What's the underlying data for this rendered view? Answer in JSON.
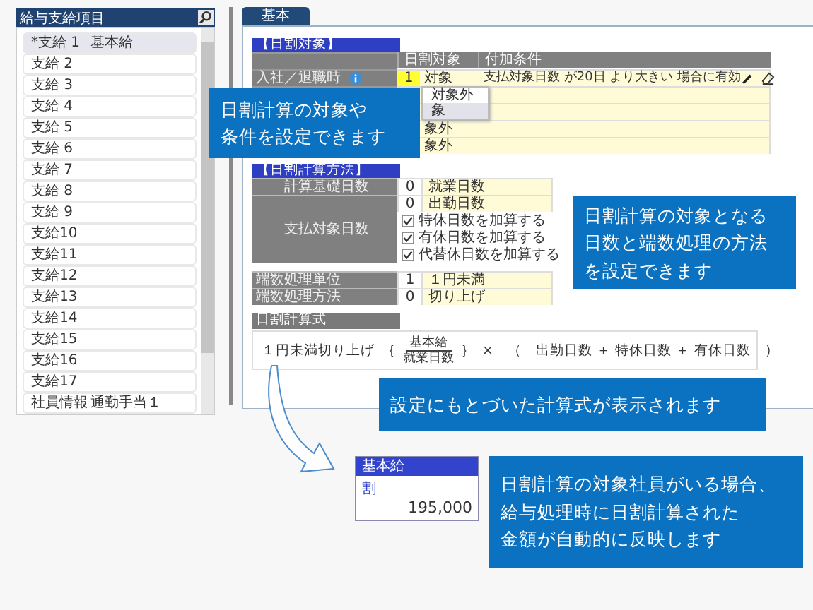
{
  "sidebar": {
    "title": "給与支給項目",
    "items": [
      {
        "code": "*支給 1",
        "name": "基本給",
        "selected": true
      },
      {
        "code": "支給 2",
        "selected": false
      },
      {
        "code": "支給 3",
        "selected": false
      },
      {
        "code": "支給 4",
        "selected": false
      },
      {
        "code": "支給 5",
        "selected": false
      },
      {
        "code": "支給 6",
        "selected": false
      },
      {
        "code": "支給 7",
        "selected": false
      },
      {
        "code": "支給 8",
        "selected": false
      },
      {
        "code": "支給 9",
        "selected": false
      },
      {
        "code": "支給10",
        "selected": false
      },
      {
        "code": "支給11",
        "selected": false
      },
      {
        "code": "支給12",
        "selected": false
      },
      {
        "code": "支給13",
        "selected": false
      },
      {
        "code": "支給14",
        "selected": false
      },
      {
        "code": "支給15",
        "selected": false
      },
      {
        "code": "支給16",
        "selected": false
      },
      {
        "code": "支給17",
        "selected": false
      },
      {
        "code": "社員情報",
        "name": "通勤手当１",
        "selected": false
      }
    ]
  },
  "tabs": [
    {
      "label": "基本",
      "selected": true
    }
  ],
  "target_section": {
    "title": "【日割対象】",
    "columns": [
      "日割対象",
      "付加条件"
    ],
    "rows": [
      {
        "label": "入社／退職時",
        "code": "1",
        "value": "対象",
        "condition": "支払対象日数 が20日 より大きい 場合に有効"
      },
      {},
      {},
      {
        "value": "象外"
      },
      {
        "value": "象外"
      }
    ],
    "dropdown": [
      {
        "label": "対象外",
        "selected": false
      },
      {
        "label": "象",
        "selected": true
      }
    ]
  },
  "method_section": {
    "title": "【日割計算方法】",
    "rows": [
      {
        "label": "計算基礎日数",
        "items": [
          {
            "kind": "value",
            "code": "0",
            "text": "就業日数"
          }
        ]
      },
      {
        "label": "支払対象日数",
        "items": [
          {
            "kind": "value",
            "code": "0",
            "text": "出勤日数"
          },
          {
            "kind": "check",
            "checked": true,
            "text": "特休日数を加算する"
          },
          {
            "kind": "check",
            "checked": true,
            "text": "有休日数を加算する"
          },
          {
            "kind": "check",
            "checked": true,
            "text": "代替休日数を加算する"
          }
        ]
      }
    ]
  },
  "rounding": [
    {
      "label": "端数処理単位",
      "code": "1",
      "value": "１円未満"
    },
    {
      "label": "端数処理方法",
      "code": "0",
      "value": "切り上げ"
    }
  ],
  "formula": {
    "title": "日割計算式",
    "prefix": "１円未満切り上げ",
    "open_brace": "｛",
    "numerator": "基本給",
    "denominator": "就業日数",
    "close_brace": "｝",
    "rest": "×　（　出勤日数 ＋ 特休日数 ＋ 有休日数　）"
  },
  "result_card": {
    "title": "基本給",
    "mark": "割",
    "amount": "195,000"
  },
  "callouts": [
    {
      "lines": [
        "日割計算の対象や",
        "条件を設定できます"
      ]
    },
    {
      "lines": [
        "日割計算の対象となる",
        "日数と端数処理の方法",
        "を設定できます"
      ]
    },
    {
      "lines": [
        "設定にもとづいた計算式が表示されます"
      ]
    },
    {
      "lines": [
        "日割計算の対象社員がいる場合、",
        "給与処理時に日割計算された",
        "金額が自動的に反映します"
      ]
    }
  ]
}
